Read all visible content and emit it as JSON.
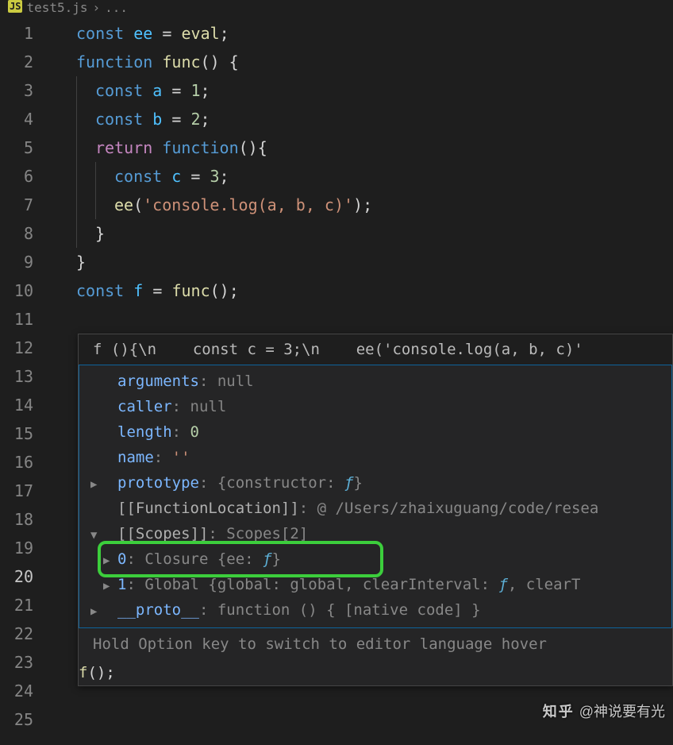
{
  "breadcrumb": {
    "icon": "JS",
    "file": "test5.js",
    "sep": "›",
    "more": "..."
  },
  "lineNumbers": [
    "1",
    "2",
    "3",
    "4",
    "5",
    "6",
    "7",
    "8",
    "9",
    "10",
    "11",
    "12",
    "13",
    "14",
    "15",
    "16",
    "17",
    "18",
    "19",
    "20",
    "21",
    "22",
    "23",
    "24",
    "25"
  ],
  "activeLine": "20",
  "code": {
    "l1": {
      "kw": "const",
      "v": "ee",
      "eq": "=",
      "rhs": "eval",
      "end": ";"
    },
    "l2": {
      "kw": "function",
      "fn": "func",
      "par": "() {"
    },
    "l3": {
      "kw": "const",
      "v": "a",
      "eq": "=",
      "n": "1",
      "end": ";"
    },
    "l4": {
      "kw": "const",
      "v": "b",
      "eq": "=",
      "n": "2",
      "end": ";"
    },
    "l5": {
      "kw": "return",
      "fn": "function",
      "par": "(){"
    },
    "l6": {
      "kw": "const",
      "v": "c",
      "eq": "=",
      "n": "3",
      "end": ";"
    },
    "l7": {
      "fn": "ee",
      "open": "(",
      "str": "'console.log(a, b, c)'",
      "close": ");"
    },
    "l8": {
      "brace": "}"
    },
    "l9": {
      "brace": "}"
    },
    "l10": {
      "kw": "const",
      "v": "f",
      "eq": "=",
      "fn": "func",
      "call": "();"
    },
    "l25": {
      "fn": "f",
      "call": "();"
    }
  },
  "hover": {
    "header": "f (){\\n    const c = 3;\\n    ee('console.log(a, b, c)'",
    "props": {
      "arguments": {
        "k": "arguments",
        "v": "null"
      },
      "caller": {
        "k": "caller",
        "v": "null"
      },
      "length": {
        "k": "length",
        "v": "0"
      },
      "name": {
        "k": "name",
        "v": "''"
      },
      "prototype": {
        "k": "prototype",
        "v": "{constructor: ",
        "f": "ƒ",
        "close": "}"
      },
      "funcloc": {
        "k": "[[FunctionLocation]]",
        "v": "@ /Users/zhaixuguang/code/resea"
      },
      "scopes": {
        "k": "[[Scopes]]",
        "v": "Scopes[2]"
      },
      "scope0": {
        "k": "0",
        "t": "Closure ",
        "body": "{ee: ",
        "f": "ƒ",
        "close": "}"
      },
      "scope1": {
        "k": "1",
        "t": "Global ",
        "body": "{global: global, clearInterval: ",
        "f": "ƒ",
        "more": ", clearT"
      },
      "proto": {
        "k": "__proto__",
        "v": "function () { [native code] }"
      }
    },
    "footer": "Hold Option key to switch to editor language hover"
  },
  "watermark": {
    "logo": "知乎",
    "author": "@神说要有光"
  }
}
